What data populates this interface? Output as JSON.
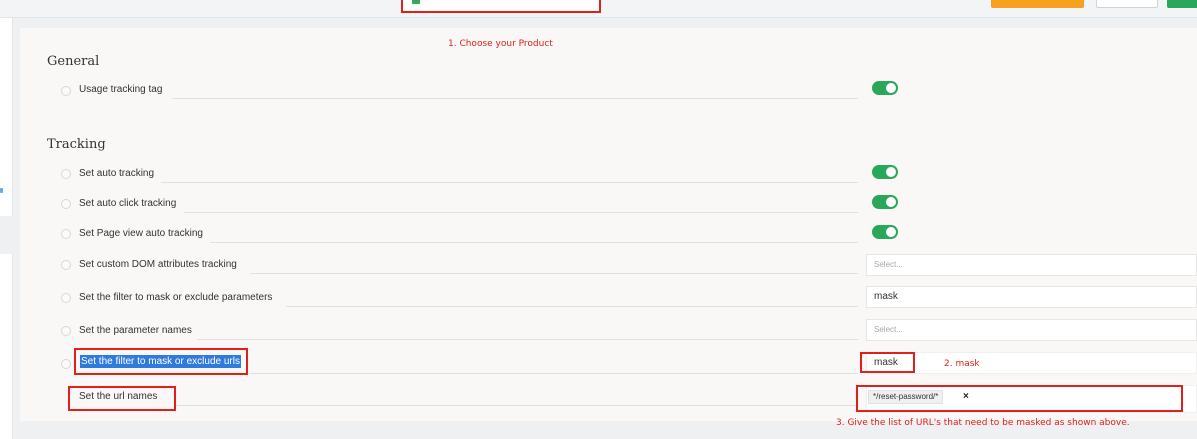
{
  "annotations": {
    "step1": "1.  Choose your Product",
    "step2": "2. mask",
    "step3": "3. Give the list of URL's that need to be masked as shown above."
  },
  "sections": {
    "general": {
      "title": "General",
      "rows": [
        {
          "label": "Usage tracking tag",
          "control": "toggle",
          "checked": true
        }
      ]
    },
    "tracking": {
      "title": "Tracking",
      "rows": [
        {
          "label": "Set auto tracking",
          "control": "toggle",
          "checked": true
        },
        {
          "label": "Set auto click tracking",
          "control": "toggle",
          "checked": true
        },
        {
          "label": "Set Page view auto tracking",
          "control": "toggle",
          "checked": true
        },
        {
          "label": "Set custom DOM attributes tracking",
          "control": "select",
          "placeholder": "Select..."
        },
        {
          "label": "Set the filter to mask or exclude parameters",
          "control": "select",
          "value": "mask"
        },
        {
          "label": "Set the parameter names",
          "control": "select",
          "placeholder": "Select..."
        },
        {
          "label": "Set the filter to mask or exclude urls",
          "control": "select",
          "value": "mask"
        },
        {
          "label": "Set the url names",
          "control": "tags",
          "tags": [
            "*/reset-password/*"
          ],
          "tag_remove": "×"
        }
      ]
    }
  },
  "colors": {
    "toggle_on": "#2aa75b",
    "annotation_red": "#e0201b",
    "selection_blue": "#2f7bdc",
    "reset_button": "#f7a21c",
    "save_button": "#2aa75b"
  },
  "icons": {
    "row_info": "info-icon",
    "product": "product-icon",
    "tag_remove": "close-icon"
  }
}
